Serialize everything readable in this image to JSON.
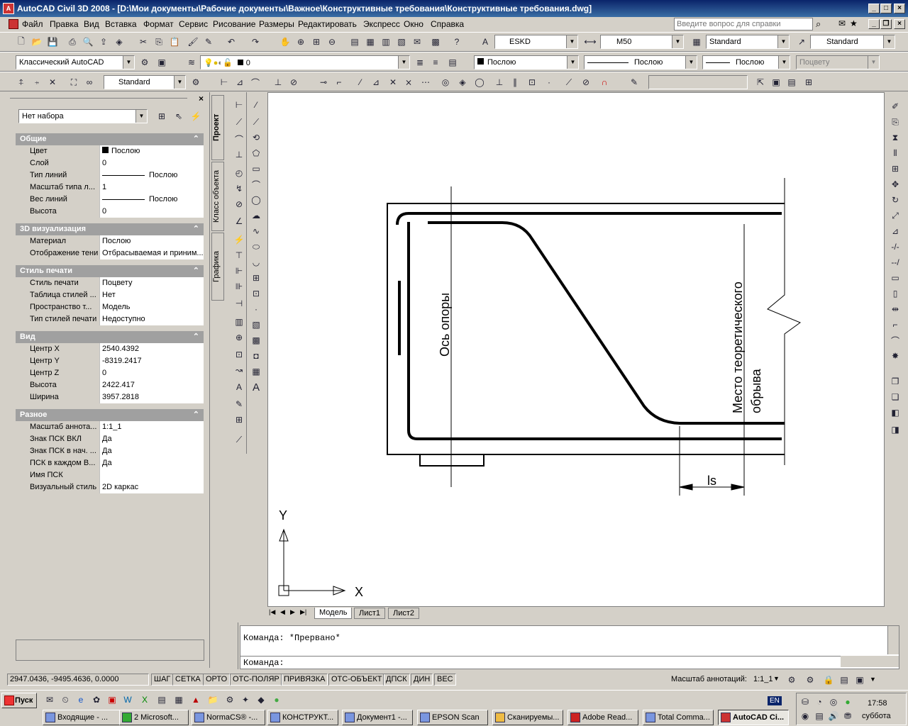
{
  "title": "AutoCAD Civil 3D 2008 - [D:\\Мои документы\\Рабочие документы\\Важное\\Конструктивные требования\\Конструктивные требования.dwg]",
  "help_placeholder": "Введите вопрос для справки",
  "menu": [
    "Файл",
    "Правка",
    "Вид",
    "Вставка",
    "Формат",
    "Сервис",
    "Рисование",
    "Размеры",
    "Редактировать",
    "Экспресс",
    "Окно",
    "Справка"
  ],
  "toolbar": {
    "text_style": "ESKD",
    "dim_style": "M50",
    "table_style": "Standard",
    "mleader_style": "Standard",
    "workspace": "Классический AutoCAD",
    "layer": "0",
    "color": "Послою",
    "linetype": "Послою",
    "lineweight": "Послою",
    "plotstyle": "Поцвету",
    "named_view": "Standard"
  },
  "props": {
    "selection": "Нет набора",
    "sections": [
      {
        "title": "Общие",
        "rows": [
          [
            "Цвет",
            "Послою"
          ],
          [
            "Слой",
            "0"
          ],
          [
            "Тип линий",
            "Послою"
          ],
          [
            "Масштаб типа л...",
            "1"
          ],
          [
            "Вес линий",
            "Послою"
          ],
          [
            "Высота",
            "0"
          ]
        ]
      },
      {
        "title": "3D визуализация",
        "rows": [
          [
            "Материал",
            "Послою"
          ],
          [
            "Отображение тени",
            "Отбрасываемая и приним..."
          ]
        ]
      },
      {
        "title": "Стиль печати",
        "rows": [
          [
            "Стиль печати",
            "Поцвету"
          ],
          [
            "Таблица стилей ...",
            "Нет"
          ],
          [
            "Пространство т...",
            "Модель"
          ],
          [
            "Тип стилей печати",
            "Недоступно"
          ]
        ]
      },
      {
        "title": "Вид",
        "rows": [
          [
            "Центр X",
            "2540.4392"
          ],
          [
            "Центр Y",
            "-8319.2417"
          ],
          [
            "Центр Z",
            "0"
          ],
          [
            "Высота",
            "2422.417"
          ],
          [
            "Ширина",
            "3957.2818"
          ]
        ]
      },
      {
        "title": "Разное",
        "rows": [
          [
            "Масштаб аннота...",
            "1:1_1"
          ],
          [
            "Знак ПСК ВКЛ",
            "Да"
          ],
          [
            "Знак ПСК в нач. ...",
            "Да"
          ],
          [
            "ПСК в каждом В...",
            "Да"
          ],
          [
            "Имя ПСК",
            ""
          ],
          [
            "Визуальный стиль",
            "2D каркас"
          ]
        ]
      }
    ]
  },
  "side_tabs": [
    "Проект",
    "Класс объекта",
    "Графика"
  ],
  "drawing": {
    "label1": "Ось опоры",
    "label2": "Место теоретического",
    "label3": "обрыва",
    "dim": "ls",
    "ucs_x": "X",
    "ucs_y": "Y"
  },
  "layout_tabs": [
    "Модель",
    "Лист1",
    "Лист2"
  ],
  "command": {
    "line1": "Команда: *Прервано*",
    "line2": "Команда:"
  },
  "status": {
    "coords": "2947.0436, -9495.4636, 0.0000",
    "buttons": [
      "ШАГ",
      "СЕТКА",
      "ОРТО",
      "ОТС-ПОЛЯР",
      "ПРИВЯЗКА",
      "ОТС-ОБЪЕКТ",
      "ДПСК",
      "ДИН",
      "ВЕС"
    ],
    "annot_label": "Масштаб аннотаций:",
    "annot_value": "1:1_1"
  },
  "taskbar": {
    "start": "Пуск",
    "tasks": [
      "Входящие - ...",
      "2 Microsoft...",
      "NormaCS® -...",
      "КОНСТРУКТ...",
      "Документ1 -...",
      "EPSON Scan",
      "Сканируемы...",
      "Adobe Read...",
      "Total Comma...",
      "AutoCAD Ci..."
    ],
    "lang": "EN",
    "time": "17:58",
    "day": "суббота"
  }
}
